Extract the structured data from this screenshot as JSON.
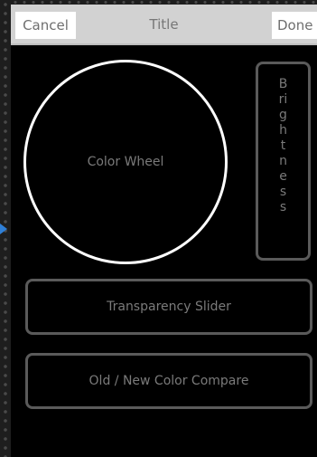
{
  "nav": {
    "cancel_label": "Cancel",
    "title": "Title",
    "done_label": "Done"
  },
  "color_wheel": {
    "label": "Color Wheel"
  },
  "brightness": {
    "label": "Brightness"
  },
  "transparency_slider": {
    "label": "Transparency Slider"
  },
  "color_compare": {
    "label": "Old / New Color Compare"
  },
  "colors": {
    "background": "#000000",
    "nav_bar": "#d2d2d2",
    "outline": "#5a5a5a",
    "wheel_outline": "#ffffff",
    "marker": "#2f7fd6"
  }
}
